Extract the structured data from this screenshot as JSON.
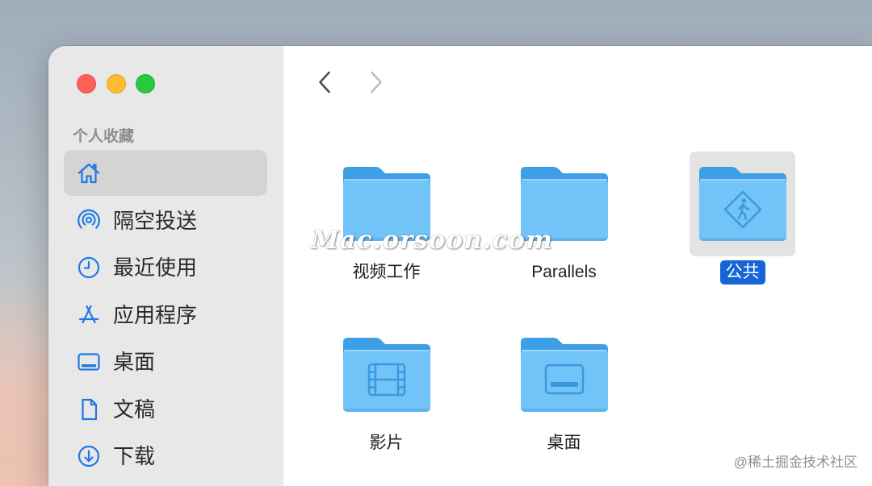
{
  "window": {
    "controls": [
      {
        "name": "close",
        "color": "#fe5f57"
      },
      {
        "name": "minimize",
        "color": "#febc2e"
      },
      {
        "name": "zoom",
        "color": "#28c840"
      }
    ]
  },
  "sidebar": {
    "section_title": "个人收藏",
    "items": [
      {
        "icon": "home-icon",
        "selected": true
      },
      {
        "icon": "airdrop-icon",
        "label": "隔空投送"
      },
      {
        "icon": "clock-icon",
        "label": "最近使用"
      },
      {
        "icon": "app-store-icon",
        "label": "应用程序"
      },
      {
        "icon": "desktop-icon",
        "label": "桌面"
      },
      {
        "icon": "document-icon",
        "label": "文稿"
      },
      {
        "icon": "download-icon",
        "label": "下载"
      }
    ]
  },
  "toolbar": {
    "back_icon": "chevron-left-icon",
    "forward_icon": "chevron-right-icon",
    "forward_enabled": false
  },
  "files": [
    {
      "name": "视频工作",
      "icon": "folder-icon",
      "selected": false
    },
    {
      "name": "Parallels",
      "icon": "folder-icon",
      "selected": false
    },
    {
      "name": "公共",
      "icon": "folder-icon",
      "emblem": "public-sign-icon",
      "selected": true
    },
    {
      "name": "影片",
      "icon": "folder-icon",
      "emblem": "film-icon",
      "selected": false
    },
    {
      "name": "桌面",
      "icon": "folder-icon",
      "emblem": "desktop-icon",
      "selected": false
    }
  ],
  "watermarks": {
    "site": "Mac.orsoon.com",
    "community": "@稀土掘金技术社区"
  },
  "colors": {
    "accent": "#1764d6",
    "sidebar_icon": "#2079e3",
    "sidebar_selection": "#d4d4d4",
    "file_selection": "#e3e3e3",
    "folder_back": "#3d9fe6",
    "folder_front": "#72c3f7",
    "folder_emblem": "#3a99dd"
  }
}
